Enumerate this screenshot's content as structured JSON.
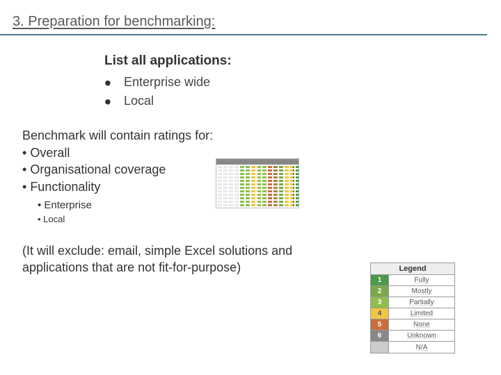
{
  "title": "3. Preparation for benchmarking:",
  "list": {
    "heading": "List all applications:",
    "items": [
      "Enterprise wide",
      "Local"
    ]
  },
  "benchmark": {
    "heading": "Benchmark will contain ratings for:",
    "items": [
      "Overall",
      "Organisational coverage",
      "Functionality"
    ],
    "sub": [
      "Enterprise",
      "Local"
    ]
  },
  "exclusion": "(It will exclude: email, simple Excel solutions and applications that are not fit-for-purpose)",
  "legend": {
    "title": "Legend",
    "rows": [
      {
        "n": "1",
        "label": "Fully",
        "cls": "c1"
      },
      {
        "n": "2",
        "label": "Mostly",
        "cls": "c2"
      },
      {
        "n": "3",
        "label": "Partially",
        "cls": "c3"
      },
      {
        "n": "4",
        "label": "Limited",
        "cls": "c4"
      },
      {
        "n": "5",
        "label": "None",
        "cls": "c5"
      },
      {
        "n": "6",
        "label": "Unknown",
        "cls": "c6"
      },
      {
        "n": "",
        "label": "N/A",
        "cls": "c7"
      }
    ]
  }
}
